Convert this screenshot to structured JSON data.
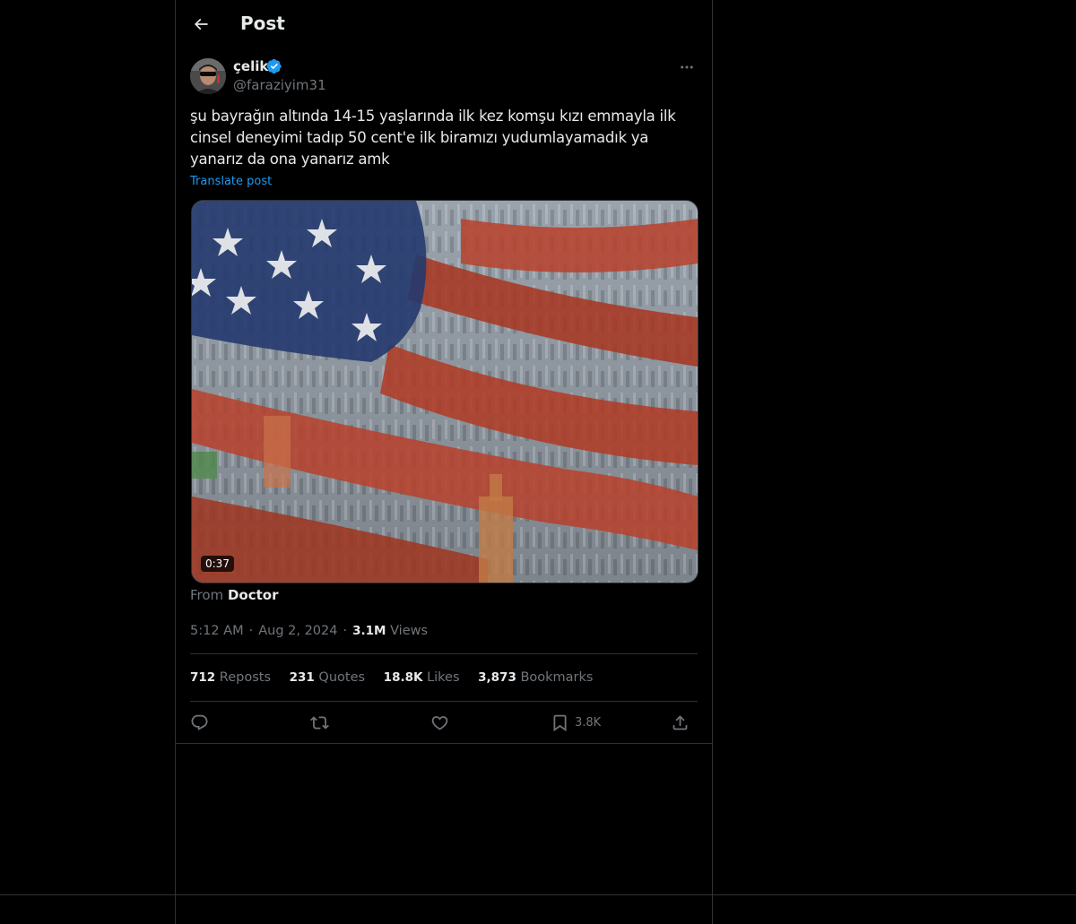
{
  "header": {
    "back_icon": "arrow-left-icon",
    "title": "Post"
  },
  "post": {
    "author": {
      "display_name": "çelik",
      "handle": "@faraziyim31",
      "verified": true,
      "verified_color": "#1d9bf0"
    },
    "text": "şu bayrağın altında 14-15 yaşlarında ilk kez komşu kızı emmayla ilk cinsel deneyimi tadıp 50 cent'e ilk biramızı yudumlayamadık ya yanarız da ona yanarız amk",
    "translate_label": "Translate post",
    "media": {
      "type": "video",
      "duration": "0:37"
    },
    "from": {
      "prefix": "From",
      "source": "Doctor"
    },
    "meta": {
      "time": "5:12 AM",
      "date": "Aug 2, 2024",
      "views_count": "3.1M",
      "views_label": "Views",
      "separator": "·"
    },
    "stats": [
      {
        "count": "712",
        "label": "Reposts"
      },
      {
        "count": "231",
        "label": "Quotes"
      },
      {
        "count": "18.8K",
        "label": "Likes"
      },
      {
        "count": "3,873",
        "label": "Bookmarks"
      }
    ],
    "actions": {
      "reply_icon": "reply-icon",
      "repost_icon": "repost-icon",
      "like_icon": "heart-icon",
      "bookmark_icon": "bookmark-icon",
      "bookmark_count": "3.8K",
      "share_icon": "share-icon"
    }
  },
  "colors": {
    "background": "#000000",
    "text_primary": "#e7e9ea",
    "text_secondary": "#71767b",
    "accent": "#1d9bf0",
    "border": "#2f3336"
  }
}
